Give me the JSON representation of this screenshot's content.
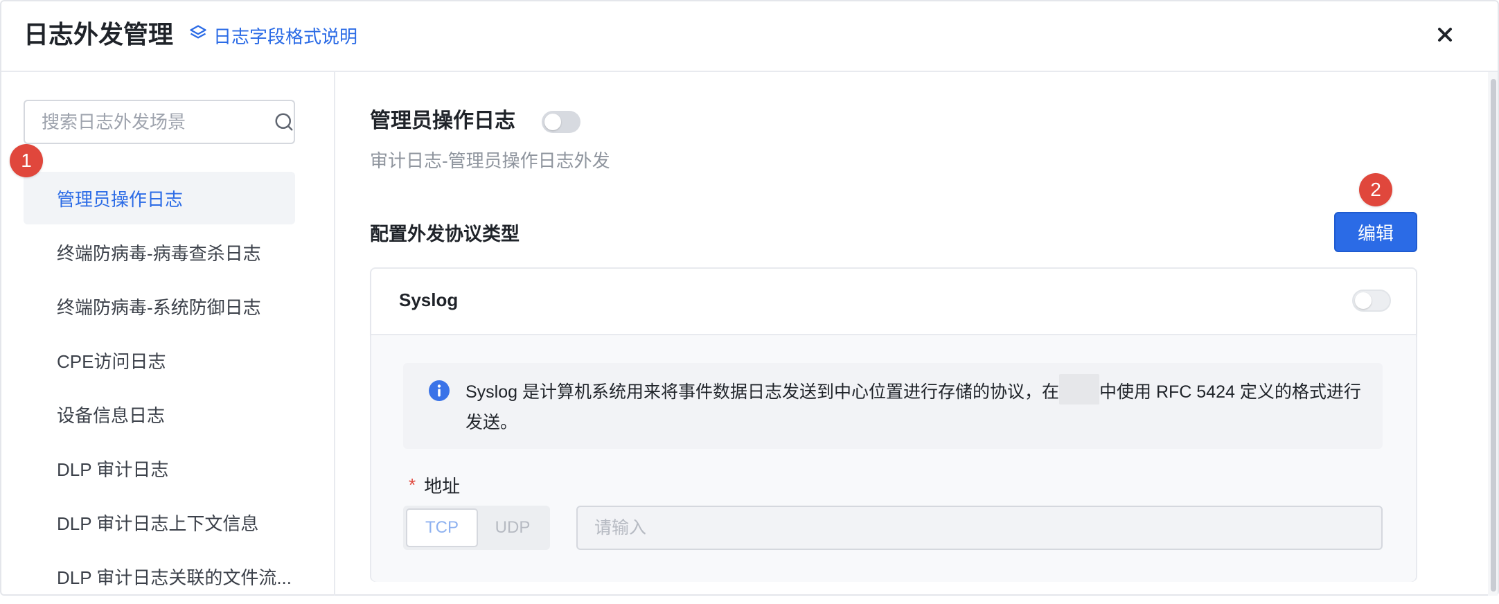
{
  "header": {
    "title": "日志外发管理",
    "doc_link": "日志字段格式说明",
    "doc_icon": "layers-icon",
    "close_icon": "close-icon"
  },
  "sidebar": {
    "search_placeholder": "搜索日志外发场景",
    "items": [
      {
        "label": "管理员操作日志",
        "active": true
      },
      {
        "label": "终端防病毒-病毒查杀日志"
      },
      {
        "label": "终端防病毒-系统防御日志"
      },
      {
        "label": "CPE访问日志"
      },
      {
        "label": "设备信息日志"
      },
      {
        "label": "DLP 审计日志"
      },
      {
        "label": "DLP 审计日志上下文信息"
      },
      {
        "label": "DLP 审计日志关联的文件流..."
      }
    ]
  },
  "badges": {
    "one": "1",
    "two": "2"
  },
  "main": {
    "title": "管理员操作日志",
    "enabled": false,
    "subtitle": "审计日志-管理员操作日志外发",
    "config_label": "配置外发协议类型",
    "edit_label": "编辑",
    "card": {
      "title": "Syslog",
      "enabled": false,
      "info_part1": "Syslog 是计算机系统用来将事件数据日志发送到中心位置进行存储的协议，在",
      "info_part2": "中使用 RFC 5424 定义的格式进行发送。",
      "address_label": "地址",
      "protocols": [
        "TCP",
        "UDP"
      ],
      "selected_protocol": "TCP",
      "address_placeholder": "请输入"
    }
  },
  "colors": {
    "accent": "#2b6be6",
    "badge": "#e0473c"
  }
}
